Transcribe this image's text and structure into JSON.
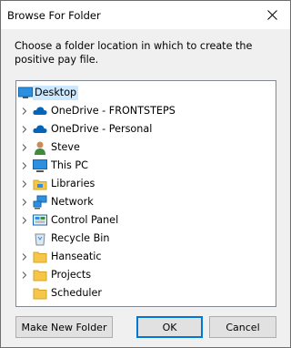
{
  "window": {
    "title": "Browse For Folder"
  },
  "prompt": "Choose a folder location in which to create the positive pay file.",
  "tree": {
    "root": {
      "label": "Desktop",
      "icon": "desktop-icon"
    },
    "items": [
      {
        "label": "OneDrive - FRONTSTEPS",
        "icon": "onedrive-icon",
        "expandable": true
      },
      {
        "label": "OneDrive - Personal",
        "icon": "onedrive-icon",
        "expandable": true
      },
      {
        "label": "Steve",
        "icon": "user-icon",
        "expandable": true
      },
      {
        "label": "This PC",
        "icon": "computer-icon",
        "expandable": true
      },
      {
        "label": "Libraries",
        "icon": "libraries-icon",
        "expandable": true
      },
      {
        "label": "Network",
        "icon": "network-icon",
        "expandable": true
      },
      {
        "label": "Control Panel",
        "icon": "control-panel-icon",
        "expandable": true
      },
      {
        "label": "Recycle Bin",
        "icon": "recycle-bin-icon",
        "expandable": false
      },
      {
        "label": "Hanseatic",
        "icon": "folder-icon",
        "expandable": true
      },
      {
        "label": "Projects",
        "icon": "folder-icon",
        "expandable": true
      },
      {
        "label": "Scheduler",
        "icon": "folder-icon",
        "expandable": false
      }
    ]
  },
  "buttons": {
    "new_folder": "Make New Folder",
    "ok": "OK",
    "cancel": "Cancel"
  },
  "colors": {
    "selection": "#cce8ff",
    "default_border": "#0078d7",
    "onedrive": "#0364b8",
    "folder": "#f6c649"
  }
}
